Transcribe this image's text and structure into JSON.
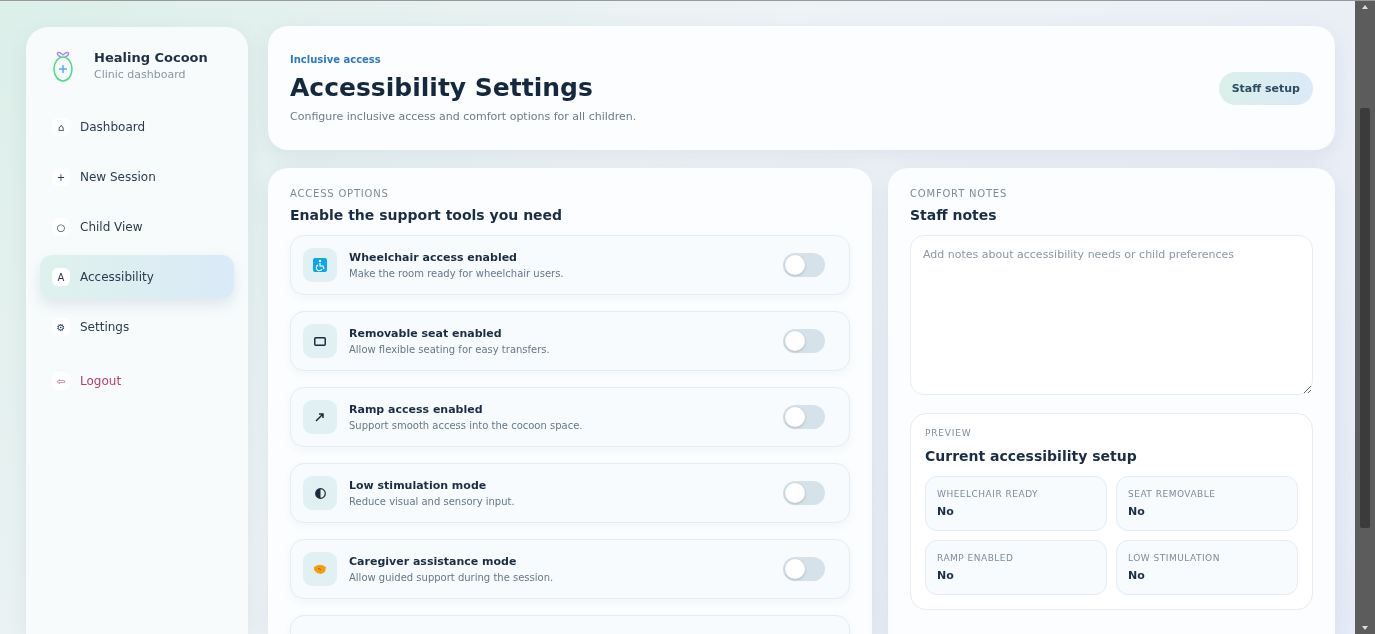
{
  "sidebar": {
    "brand": {
      "name": "Healing Cocoon",
      "subtitle": "Clinic dashboard"
    },
    "items": [
      {
        "icon": "⌂",
        "label": "Dashboard",
        "selected": false,
        "kind": "nav"
      },
      {
        "icon": "+",
        "label": "New Session",
        "selected": false,
        "kind": "nav"
      },
      {
        "icon": "○",
        "label": "Child View",
        "selected": false,
        "kind": "nav"
      },
      {
        "icon": "A",
        "label": "Accessibility",
        "selected": true,
        "kind": "nav"
      },
      {
        "icon": "⚙",
        "label": "Settings",
        "selected": false,
        "kind": "nav"
      },
      {
        "icon": "⇦",
        "label": "Logout",
        "selected": false,
        "kind": "logout"
      }
    ]
  },
  "header": {
    "eyebrow": "Inclusive access",
    "title": "Accessibility Settings",
    "subtitle": "Configure inclusive access and comfort options for all children.",
    "button": "Staff setup"
  },
  "access_options": {
    "eyebrow": "ACCESS OPTIONS",
    "title": "Enable the support tools you need",
    "options": [
      {
        "title": "Wheelchair access enabled",
        "description": "Make the room ready for wheelchair users.",
        "on": false
      },
      {
        "title": "Removable seat enabled",
        "description": "Allow flexible seating for easy transfers.",
        "on": false
      },
      {
        "title": "Ramp access enabled",
        "description": "Support smooth access into the cocoon space.",
        "on": false
      },
      {
        "title": "Low stimulation mode",
        "description": "Reduce visual and sensory input.",
        "on": false
      },
      {
        "title": "Caregiver assistance mode",
        "description": "Allow guided support during the session.",
        "on": false
      }
    ]
  },
  "comfort_notes": {
    "eyebrow": "COMFORT NOTES",
    "title": "Staff notes",
    "placeholder": "Add notes about accessibility needs or child preferences"
  },
  "preview": {
    "eyebrow": "PREVIEW",
    "title": "Current accessibility setup",
    "items": [
      {
        "label": "WHEELCHAIR READY",
        "value": "No"
      },
      {
        "label": "SEAT REMOVABLE",
        "value": "No"
      },
      {
        "label": "RAMP ENABLED",
        "value": "No"
      },
      {
        "label": "LOW STIMULATION",
        "value": "No"
      }
    ]
  }
}
